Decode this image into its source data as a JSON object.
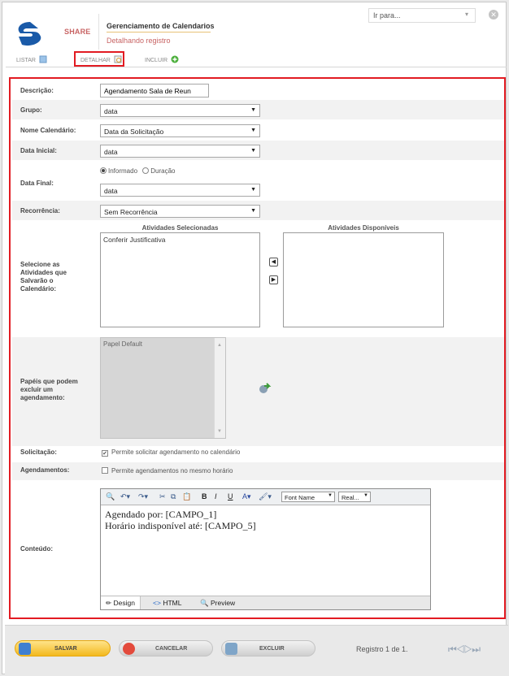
{
  "header": {
    "brand": "SHARE",
    "title": "Gerenciamento de Calendarios",
    "subtitle": "Detalhando registro",
    "goto_placeholder": "Ir para...",
    "colors": {
      "brand": "#1a5aa8",
      "accent_text": "#c86464",
      "highlight": "#e21b22"
    }
  },
  "tabs": [
    {
      "label": "LISTAR",
      "icon": "list-icon"
    },
    {
      "label": "DETALHAR",
      "icon": "detail-icon"
    },
    {
      "label": "INCLUIR",
      "icon": "add-icon"
    }
  ],
  "form": {
    "descricao": {
      "label": "Descrição:",
      "value": "Agendamento Sala de Reun"
    },
    "grupo": {
      "label": "Grupo:",
      "value": "data"
    },
    "nome_calendario": {
      "label": "Nome Calendário:",
      "value": "Data da Solicitação"
    },
    "data_inicial": {
      "label": "Data Inicial:",
      "value": "data"
    },
    "data_final": {
      "label": "Data Final:",
      "value": "data",
      "opt_informado": "Informado",
      "opt_duracao": "Duração"
    },
    "recorrencia": {
      "label": "Recorrência:",
      "value": "Sem Recorrência"
    },
    "atividades": {
      "label": "Selecione as Atividades que Salvarão o Calendário:",
      "selected_header": "Atividades Selecionadas",
      "available_header": "Atividades Disponíveis",
      "selected": [
        "Conferir Justificativa"
      ]
    },
    "papeis": {
      "label": "Papéis que podem excluir um agendamento:",
      "items": [
        "Papel Default"
      ]
    },
    "solicitacao": {
      "label": "Solicitação:",
      "text": "Permite solicitar agendamento no calendário",
      "checked": true
    },
    "agendamentos": {
      "label": "Agendamentos:",
      "text": "Permite agendamentos no mesmo horário",
      "checked": false
    },
    "conteudo": {
      "label": "Conteúdo:",
      "lines": [
        "Agendado por: [CAMPO_1]",
        "Horário indisponível até: [CAMPO_5]"
      ],
      "font_name": "Font Name",
      "font_size": "Real...",
      "tab_design": "Design",
      "tab_html": "HTML",
      "tab_preview": "Preview"
    }
  },
  "footer": {
    "salvar": "SALVAR",
    "cancelar": "CANCELAR",
    "excluir": "EXCLUIR",
    "registro": "Registro 1 de 1."
  }
}
